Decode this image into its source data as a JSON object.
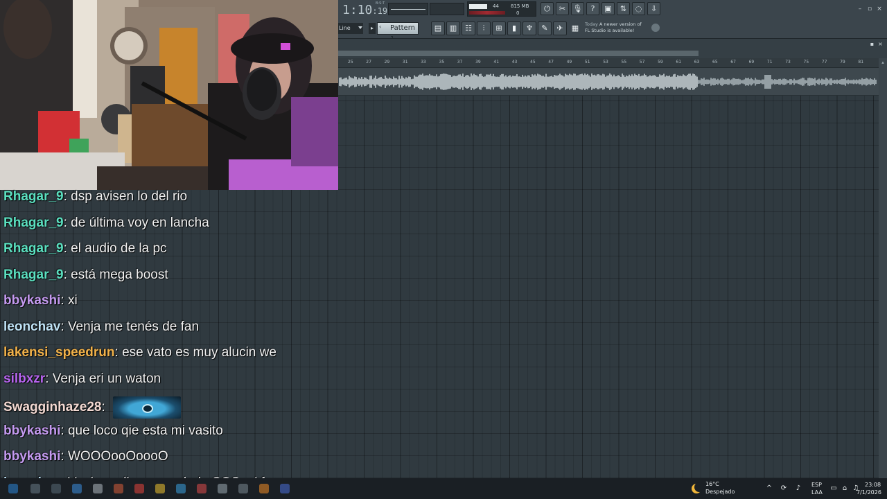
{
  "fl": {
    "time_main": "1:10",
    "time_small": "19",
    "ppq_label": "B:S:T",
    "monitor": {
      "cpu": "44",
      "memory": "815 MB",
      "poly": "0"
    },
    "snap": "Line",
    "play_mode_icon": "▸",
    "pattern": "Pattern 1",
    "news_date": "Today",
    "news_line1": "A newer version of",
    "news_line2": "FL Studio is available!",
    "window_controls": [
      "–",
      "▫",
      "×"
    ]
  },
  "ruler": [
    "25",
    "27",
    "29",
    "31",
    "33",
    "35",
    "37",
    "39",
    "41",
    "43",
    "45",
    "47",
    "49",
    "51",
    "53",
    "55",
    "57",
    "59",
    "61",
    "63",
    "65",
    "67",
    "69",
    "71",
    "73",
    "75",
    "77",
    "79",
    "81"
  ],
  "chat": [
    {
      "user": "Rhagar_9",
      "color": "#5be0c0",
      "text": "dsp avisen lo del rio"
    },
    {
      "user": "Rhagar_9",
      "color": "#5be0c0",
      "text": "de última voy en lancha"
    },
    {
      "user": "Rhagar_9",
      "color": "#5be0c0",
      "text": "el audio de la pc"
    },
    {
      "user": "Rhagar_9",
      "color": "#5be0c0",
      "text": "está mega boost"
    },
    {
      "user": "bbykashi",
      "color": "#c49af0",
      "text": "xi"
    },
    {
      "user": "leonchav",
      "color": "#bfe2f5",
      "text": "Venja me tenés de fan"
    },
    {
      "user": "lakensi_speedrun",
      "color": "#f2b24a",
      "text": "ese vato es muy alucin we"
    },
    {
      "user": "silbxzr",
      "color": "#b865f0",
      "text": "Venja eri un waton"
    },
    {
      "user": "Swagginhaze28",
      "color": "#f3d9d2",
      "text": "",
      "emote": "monster-emote"
    },
    {
      "user": "bbykashi",
      "color": "#c49af0",
      "text": "que loco qie esta mi vasito"
    },
    {
      "user": "bbykashi",
      "color": "#c49af0",
      "text": "WOOOooOoooO"
    },
    {
      "user": "leonchav",
      "color": "#bfe2f5",
      "text": "Venja pedime un saludo SOS mi fan"
    }
  ],
  "taskbar": {
    "temperature": "16°C",
    "weather": "Despejado",
    "lang_top": "ESP",
    "lang_bottom": "LAA",
    "time": "23:08",
    "date": "7/1/2026"
  }
}
